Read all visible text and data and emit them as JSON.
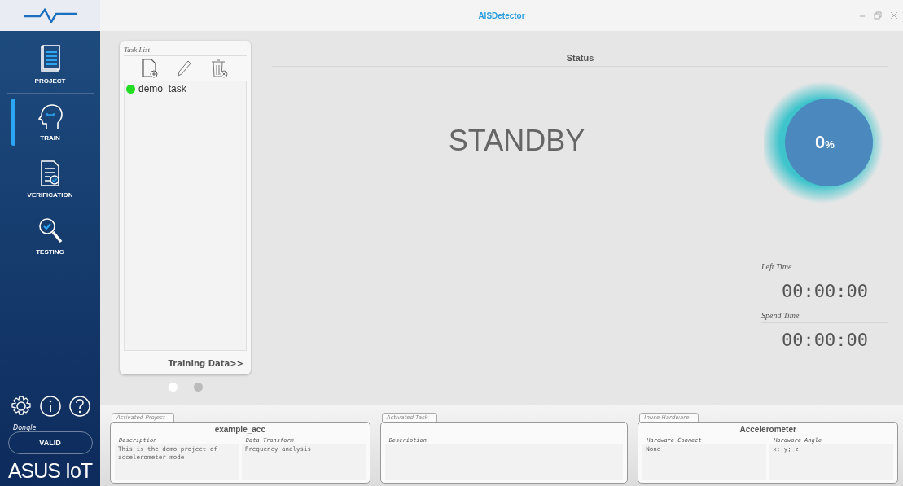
{
  "window": {
    "title": "AISDetector"
  },
  "sidebar": {
    "items": [
      {
        "label": "PROJECT",
        "kind": "project",
        "selected": false
      },
      {
        "label": "TRAIN",
        "kind": "train",
        "selected": true
      },
      {
        "label": "VERIFICATION",
        "kind": "verification",
        "selected": false
      },
      {
        "label": "TESTING",
        "kind": "testing",
        "selected": false
      }
    ],
    "dongle": {
      "label": "Dongle",
      "status": "VALID"
    },
    "brand": "ASUS IoT"
  },
  "task_list": {
    "title": "Task List",
    "tasks": [
      {
        "name": "demo_task",
        "color": "#22dd22"
      }
    ],
    "link": "Training Data>>",
    "pages": [
      {
        "selected": true
      },
      {
        "selected": false
      }
    ]
  },
  "status": {
    "title": "Status",
    "state": "STANDBY",
    "progress": {
      "value": "0",
      "unit": "%",
      "level": 0
    },
    "timers": [
      {
        "label": "Left Time",
        "value": "00:00:00"
      },
      {
        "label": "Spend Time",
        "value": "00:00:00"
      }
    ]
  },
  "panels": [
    {
      "tab": "Activated Project",
      "name": "example_acc",
      "fields": [
        {
          "label": "Description",
          "value": "This is the demo project of accelerometer mode."
        },
        {
          "label": "Data Transform",
          "value": "Frequency analysis"
        }
      ]
    },
    {
      "tab": "Activated Task",
      "fields": [
        {
          "label": "Description"
        }
      ]
    },
    {
      "tab": "Inuse Hardware",
      "name": "Accelerometer",
      "fields": [
        {
          "label": "Hardware Connect",
          "value": "None"
        },
        {
          "label": "Hardware Angle",
          "value": "x; y; z"
        }
      ]
    }
  ]
}
